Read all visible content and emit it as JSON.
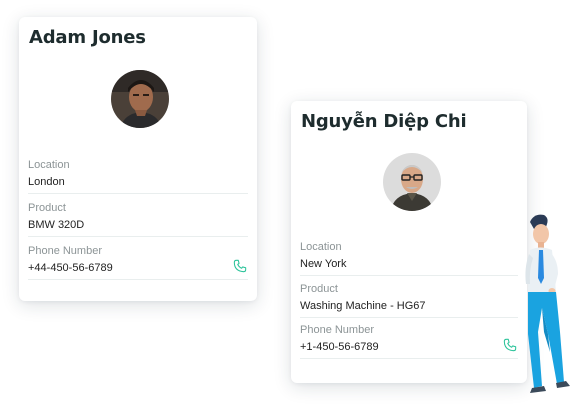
{
  "contacts": [
    {
      "name": "Adam Jones",
      "fields": [
        {
          "label": "Location",
          "value": "London"
        },
        {
          "label": "Product",
          "value": "BMW 320D"
        },
        {
          "label": "Phone Number",
          "value": "+44-450-56-6789"
        }
      ]
    },
    {
      "name": "Nguyễn Diệp Chi",
      "fields": [
        {
          "label": "Location",
          "value": "New York"
        },
        {
          "label": "Product",
          "value": "Washing Machine - HG67"
        },
        {
          "label": "Phone Number",
          "value": "+1-450-56-6789"
        }
      ]
    }
  ],
  "icons": {
    "phone": "phone-icon",
    "avatar": "avatar-photo",
    "illustration": "business-person-illustration"
  },
  "colors": {
    "accent": "#2cc39a",
    "card_background": "#ffffff",
    "label": "#8c9496",
    "divider": "#e9eeee"
  }
}
